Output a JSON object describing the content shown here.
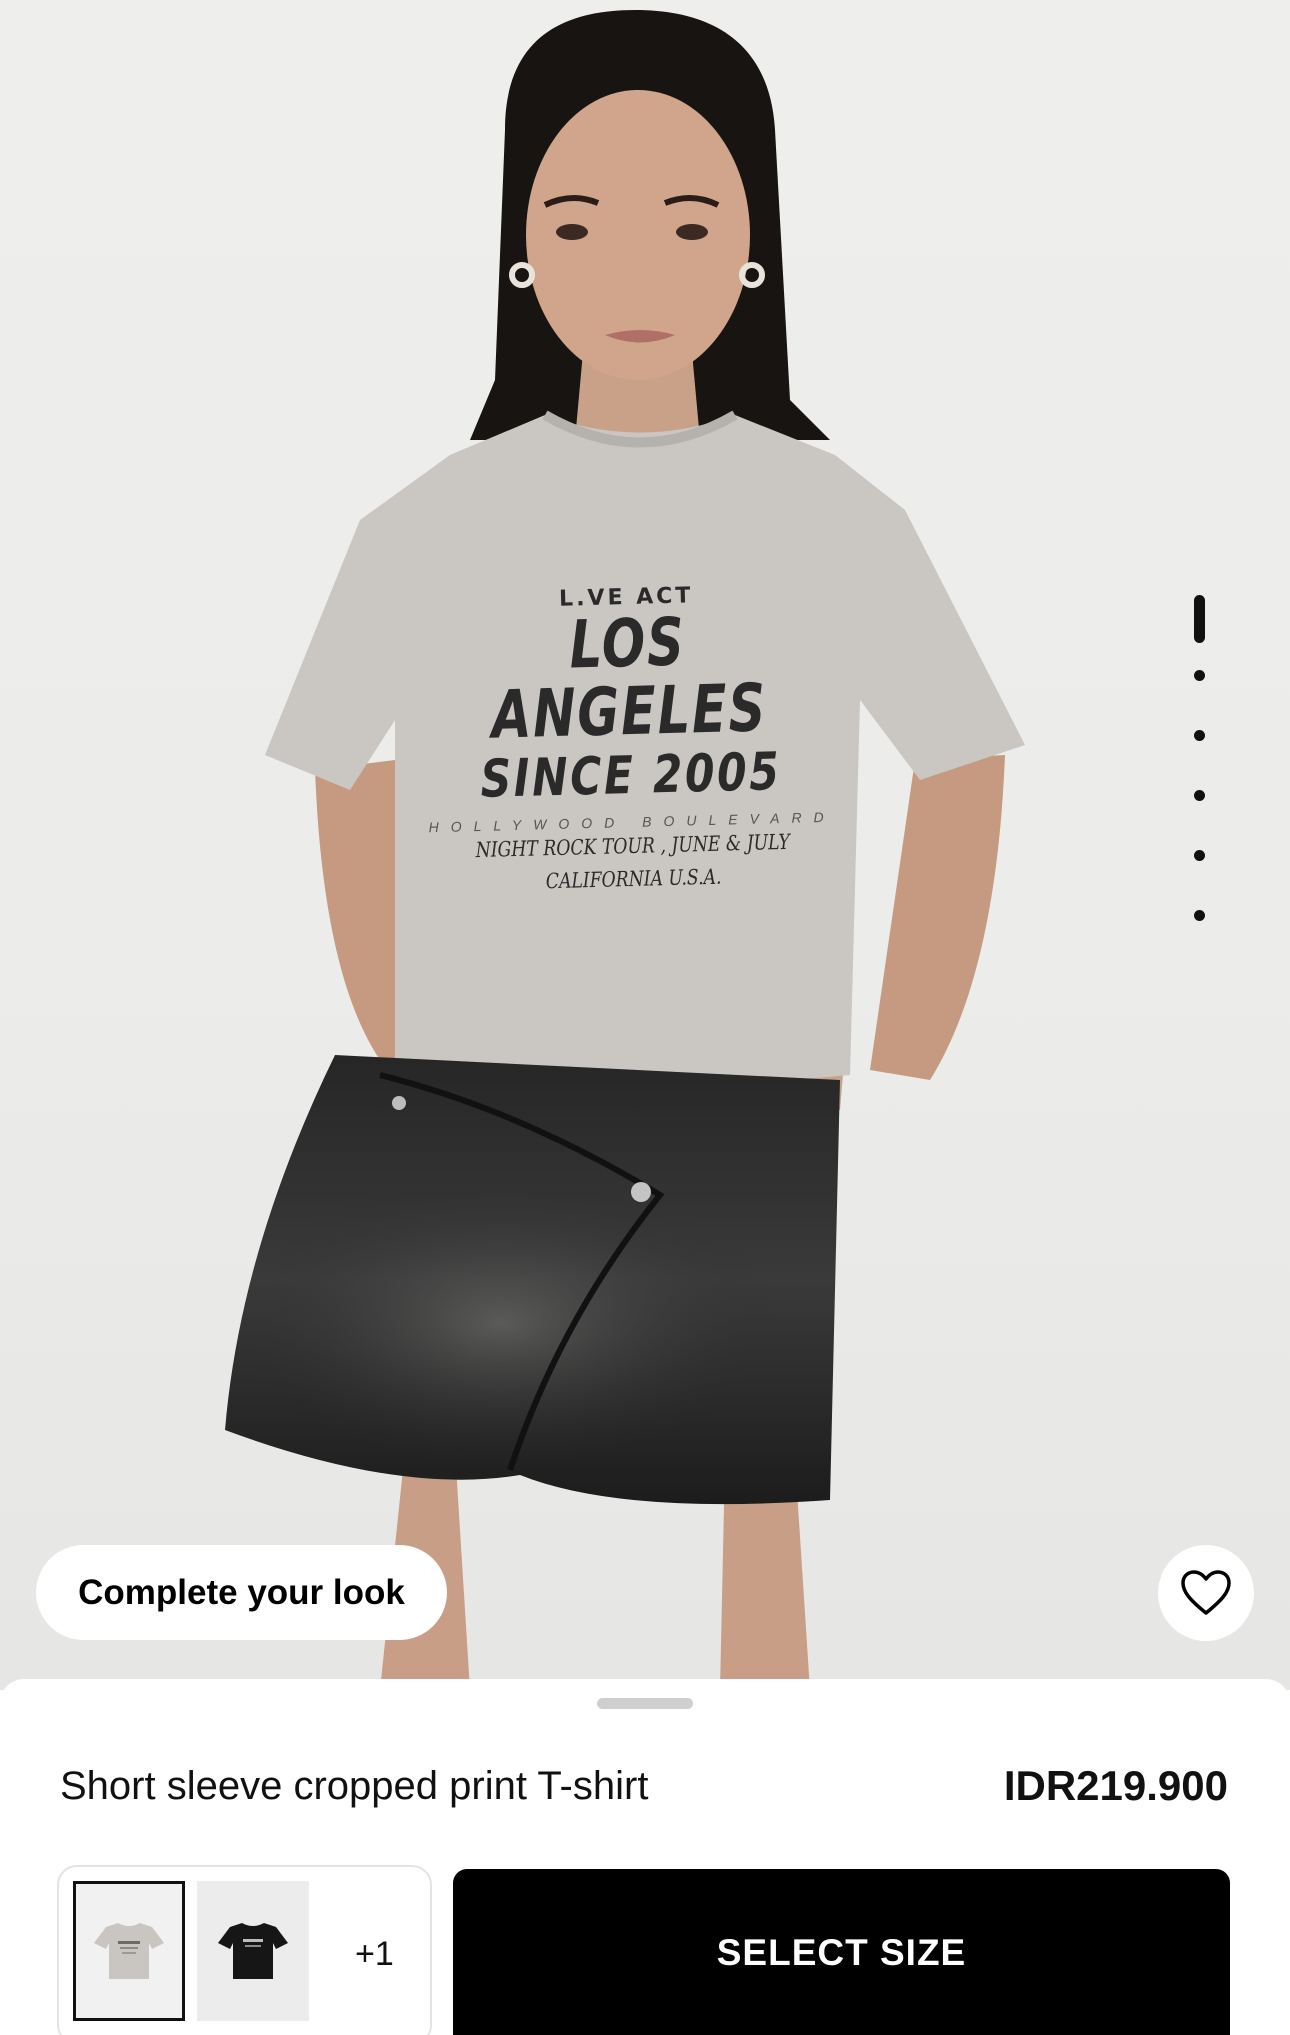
{
  "product_image": {
    "shirt_print": {
      "line1": "L.VE ACT",
      "line2": "LOS ANGELES",
      "line3": "SINCE 2005",
      "line4": "HOLLYWOOD BOULEVARD",
      "line5": "NIGHT ROCK TOUR , JUNE & JULY",
      "line6": "CALIFORNIA  U.S.A."
    },
    "gallery": {
      "total": 6,
      "current": 1
    }
  },
  "overlay": {
    "complete_look_label": "Complete your look",
    "favorite_icon": "heart-outline-icon"
  },
  "product": {
    "title": "Short sleeve cropped print T-shirt",
    "price": "IDR219.900"
  },
  "color_swatches": {
    "options": [
      {
        "name": "grey",
        "color": "#c9c5c1",
        "selected": true
      },
      {
        "name": "black",
        "color": "#161616",
        "selected": false
      }
    ],
    "more_label": "+1"
  },
  "cta": {
    "select_size_label": "SELECT SIZE"
  },
  "colors": {
    "primary": "#000000",
    "background": "#ffffff",
    "page_bg": "#eeeeec"
  }
}
